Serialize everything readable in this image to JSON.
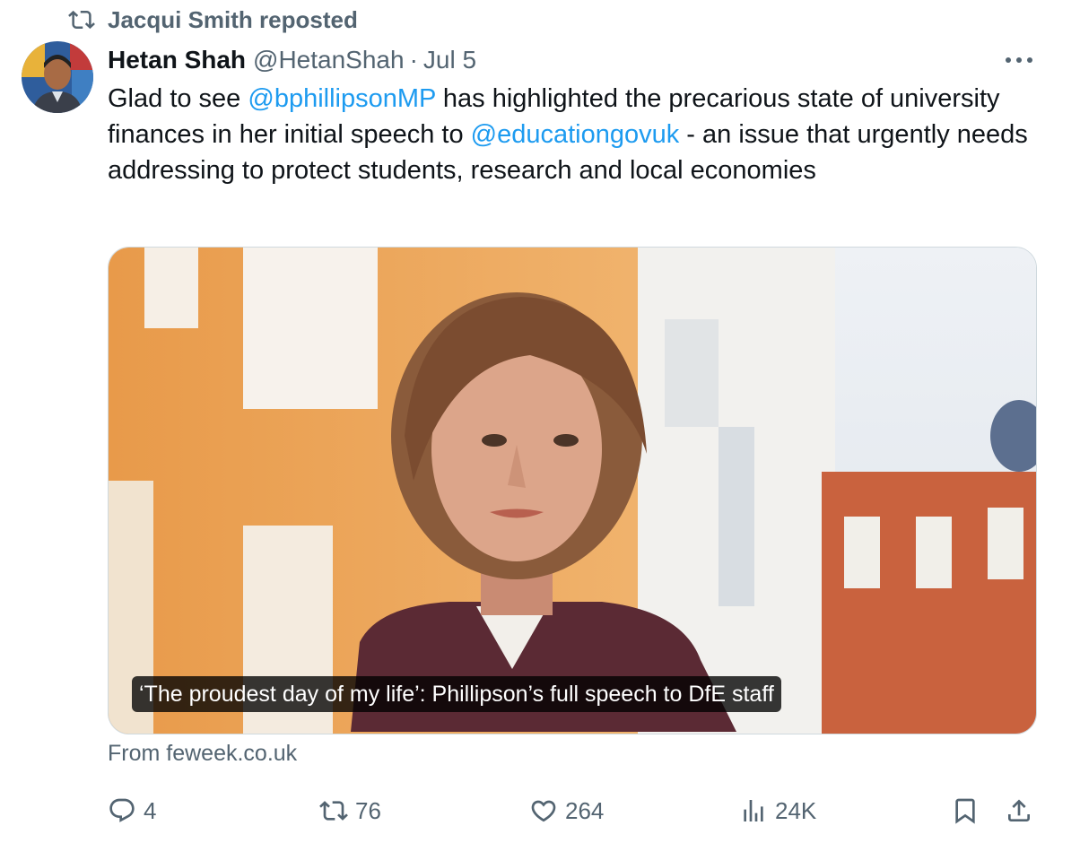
{
  "repost": {
    "icon": "repost-icon",
    "label": "Jacqui Smith reposted"
  },
  "author": {
    "avatar_icon": "avatar",
    "name": "Hetan Shah",
    "handle": "@HetanShah",
    "separator": "·",
    "date": "Jul 5"
  },
  "more_icon": "more-icon",
  "tweet": {
    "segments": [
      {
        "text": "Glad to see "
      },
      {
        "text": "@bphillipsonMP",
        "mention": true
      },
      {
        "text": " has highlighted the precarious state of university finances in her initial speech to "
      },
      {
        "text": "@educationgovuk",
        "mention": true
      },
      {
        "text": " - an issue that urgently needs addressing to protect students, research and local economies"
      }
    ]
  },
  "card": {
    "caption": "‘The proudest day of my life’: Phillipson’s full speech to DfE staff",
    "source": "From feweek.co.uk"
  },
  "actions": {
    "reply": {
      "icon": "reply-icon",
      "count": "4"
    },
    "repost": {
      "icon": "repost-icon",
      "count": "76"
    },
    "like": {
      "icon": "heart-icon",
      "count": "264"
    },
    "views": {
      "icon": "views-icon",
      "count": "24K"
    },
    "bookmark": {
      "icon": "bookmark-icon"
    },
    "share": {
      "icon": "share-icon"
    }
  },
  "colors": {
    "text": "#0f1419",
    "secondary": "#536471",
    "link": "#1d9bf0",
    "border": "#cfd9de"
  }
}
